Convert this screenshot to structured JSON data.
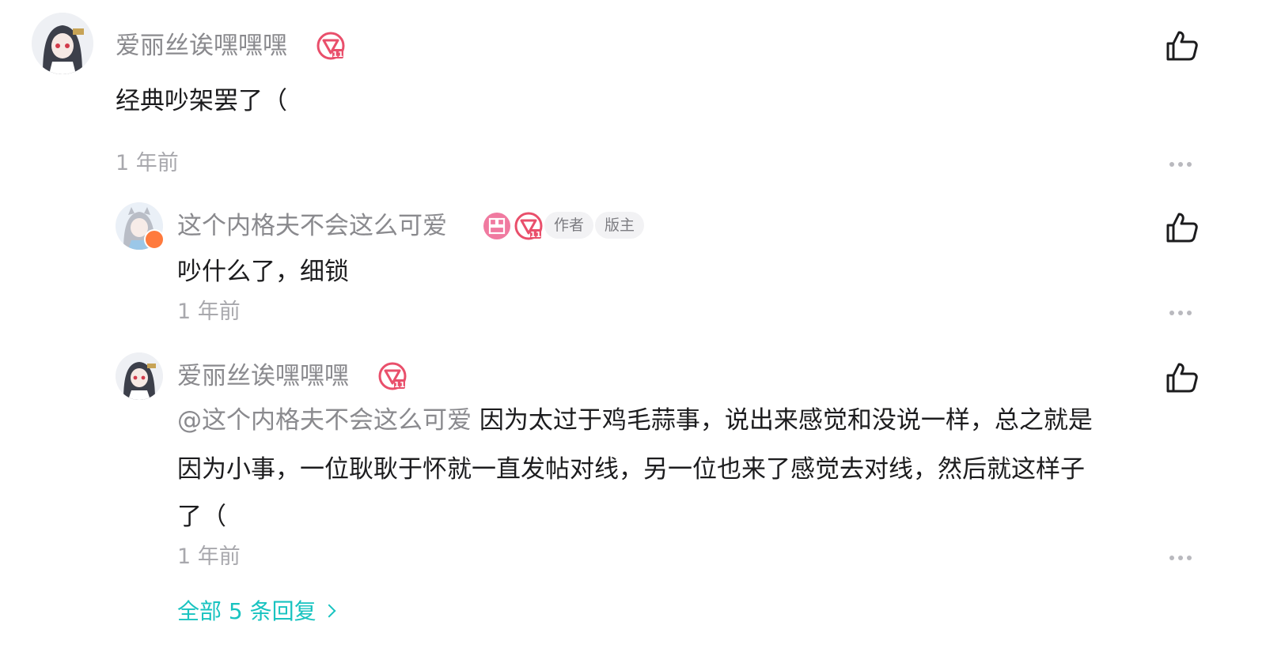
{
  "comments": [
    {
      "username": "爱丽丝诶嘿嘿嘿",
      "level_badge": "level-11-badge",
      "content": "经典吵架罢了（",
      "time": "1 年前"
    },
    {
      "username": "这个内格夫不会这么可爱",
      "medal_badge": "medal-badge",
      "level_badge": "level-11-badge",
      "tags": [
        "作者",
        "版主"
      ],
      "content": "吵什么了，细锁",
      "time": "1 年前"
    },
    {
      "username": "爱丽丝诶嘿嘿嘿",
      "level_badge": "level-11-badge",
      "mention": "@这个内格夫不会这么可爱",
      "content_lines": [
        "因为太过于鸡毛蒜事，说出来感觉和没说一样，总之就是",
        "因为小事，一位耿耿于怀就一直发帖对线，另一位也来了感觉去对线，然后就这样子",
        "了（"
      ],
      "time": "1 年前"
    }
  ],
  "view_all_replies": "全部 5 条回复",
  "colors": {
    "accent": "#18c3c0",
    "level_badge": "#e94f6b",
    "medal_badge": "#f07aa0",
    "username": "#8a8a8e",
    "timestamp": "#a8a8ad"
  },
  "icons": {
    "like": "thumbs-up-icon",
    "more": "more-dots-icon"
  }
}
